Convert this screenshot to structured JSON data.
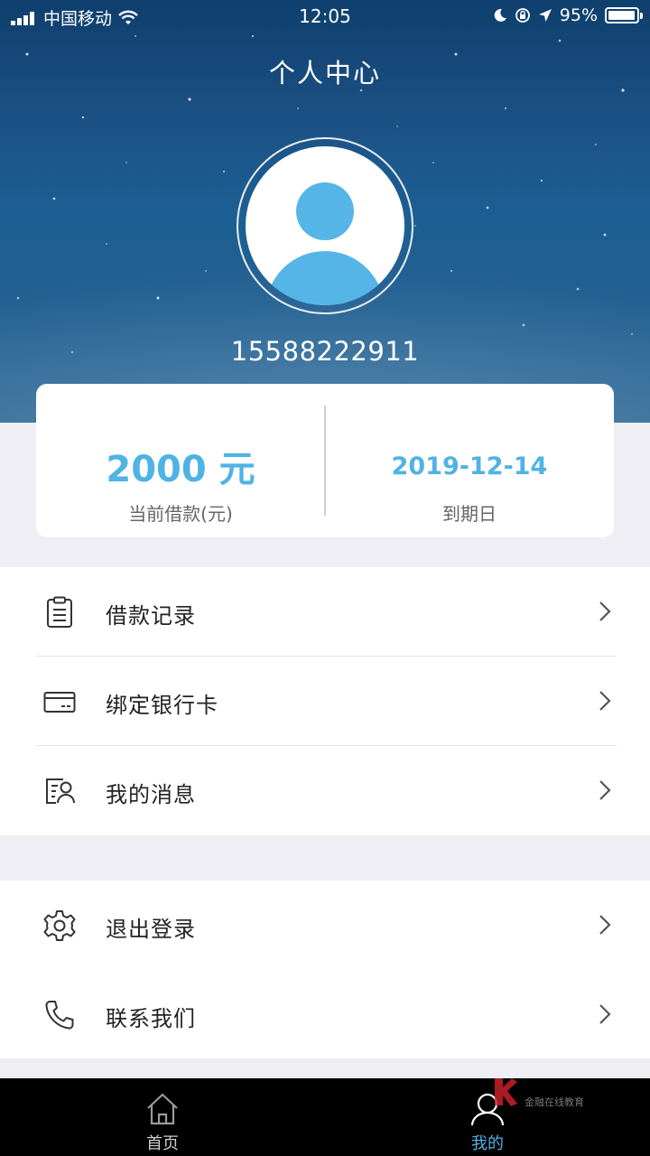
{
  "status_bar": {
    "carrier": "中国移动",
    "time": "12:05",
    "battery": "95%",
    "battery_level": 0.95
  },
  "header": {
    "title": "个人中心",
    "phone": "15588222911"
  },
  "loan_card": {
    "amount": "2000 元",
    "amount_label": "当前借款(元)",
    "due_date": "2019-12-14",
    "due_label": "到期日"
  },
  "menu_group1": [
    {
      "label": "借款记录",
      "icon": "clipboard-icon"
    },
    {
      "label": "绑定银行卡",
      "icon": "bank-card-icon"
    },
    {
      "label": "我的消息",
      "icon": "message-user-icon"
    }
  ],
  "menu_group2": [
    {
      "label": "退出登录",
      "icon": "gear-icon"
    },
    {
      "label": "联系我们",
      "icon": "phone-icon"
    }
  ],
  "tabbar": {
    "home_label": "首页",
    "mine_label": "我的",
    "active": "mine",
    "active_color": "#4fb3e3",
    "inactive_color": "#9a9a9a"
  },
  "watermark": {
    "text": "金融在线教育"
  },
  "colors": {
    "accent": "#4fb3e3",
    "avatar": "#55b5e6"
  }
}
